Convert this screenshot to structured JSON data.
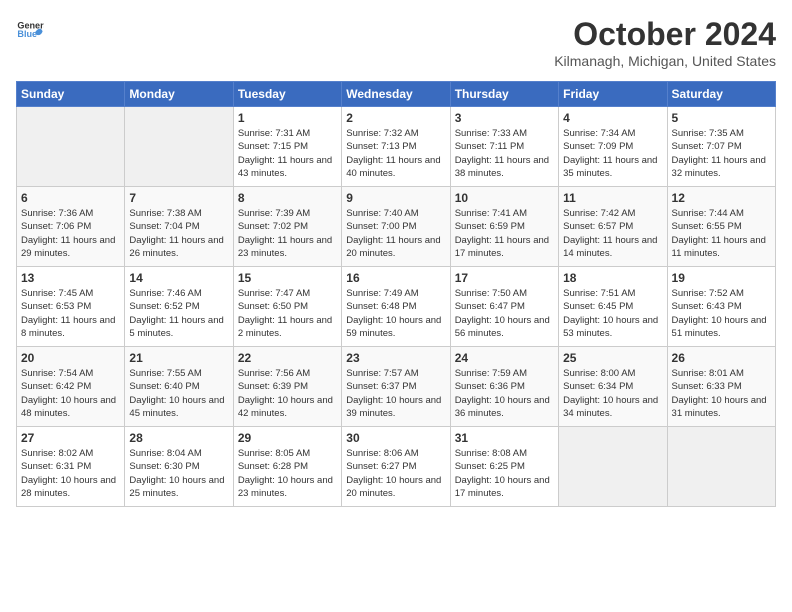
{
  "logo": {
    "general": "General",
    "blue": "Blue"
  },
  "title": "October 2024",
  "location": "Kilmanagh, Michigan, United States",
  "days_of_week": [
    "Sunday",
    "Monday",
    "Tuesday",
    "Wednesday",
    "Thursday",
    "Friday",
    "Saturday"
  ],
  "weeks": [
    [
      {
        "day": "",
        "info": ""
      },
      {
        "day": "",
        "info": ""
      },
      {
        "day": "1",
        "info": "Sunrise: 7:31 AM\nSunset: 7:15 PM\nDaylight: 11 hours and 43 minutes."
      },
      {
        "day": "2",
        "info": "Sunrise: 7:32 AM\nSunset: 7:13 PM\nDaylight: 11 hours and 40 minutes."
      },
      {
        "day": "3",
        "info": "Sunrise: 7:33 AM\nSunset: 7:11 PM\nDaylight: 11 hours and 38 minutes."
      },
      {
        "day": "4",
        "info": "Sunrise: 7:34 AM\nSunset: 7:09 PM\nDaylight: 11 hours and 35 minutes."
      },
      {
        "day": "5",
        "info": "Sunrise: 7:35 AM\nSunset: 7:07 PM\nDaylight: 11 hours and 32 minutes."
      }
    ],
    [
      {
        "day": "6",
        "info": "Sunrise: 7:36 AM\nSunset: 7:06 PM\nDaylight: 11 hours and 29 minutes."
      },
      {
        "day": "7",
        "info": "Sunrise: 7:38 AM\nSunset: 7:04 PM\nDaylight: 11 hours and 26 minutes."
      },
      {
        "day": "8",
        "info": "Sunrise: 7:39 AM\nSunset: 7:02 PM\nDaylight: 11 hours and 23 minutes."
      },
      {
        "day": "9",
        "info": "Sunrise: 7:40 AM\nSunset: 7:00 PM\nDaylight: 11 hours and 20 minutes."
      },
      {
        "day": "10",
        "info": "Sunrise: 7:41 AM\nSunset: 6:59 PM\nDaylight: 11 hours and 17 minutes."
      },
      {
        "day": "11",
        "info": "Sunrise: 7:42 AM\nSunset: 6:57 PM\nDaylight: 11 hours and 14 minutes."
      },
      {
        "day": "12",
        "info": "Sunrise: 7:44 AM\nSunset: 6:55 PM\nDaylight: 11 hours and 11 minutes."
      }
    ],
    [
      {
        "day": "13",
        "info": "Sunrise: 7:45 AM\nSunset: 6:53 PM\nDaylight: 11 hours and 8 minutes."
      },
      {
        "day": "14",
        "info": "Sunrise: 7:46 AM\nSunset: 6:52 PM\nDaylight: 11 hours and 5 minutes."
      },
      {
        "day": "15",
        "info": "Sunrise: 7:47 AM\nSunset: 6:50 PM\nDaylight: 11 hours and 2 minutes."
      },
      {
        "day": "16",
        "info": "Sunrise: 7:49 AM\nSunset: 6:48 PM\nDaylight: 10 hours and 59 minutes."
      },
      {
        "day": "17",
        "info": "Sunrise: 7:50 AM\nSunset: 6:47 PM\nDaylight: 10 hours and 56 minutes."
      },
      {
        "day": "18",
        "info": "Sunrise: 7:51 AM\nSunset: 6:45 PM\nDaylight: 10 hours and 53 minutes."
      },
      {
        "day": "19",
        "info": "Sunrise: 7:52 AM\nSunset: 6:43 PM\nDaylight: 10 hours and 51 minutes."
      }
    ],
    [
      {
        "day": "20",
        "info": "Sunrise: 7:54 AM\nSunset: 6:42 PM\nDaylight: 10 hours and 48 minutes."
      },
      {
        "day": "21",
        "info": "Sunrise: 7:55 AM\nSunset: 6:40 PM\nDaylight: 10 hours and 45 minutes."
      },
      {
        "day": "22",
        "info": "Sunrise: 7:56 AM\nSunset: 6:39 PM\nDaylight: 10 hours and 42 minutes."
      },
      {
        "day": "23",
        "info": "Sunrise: 7:57 AM\nSunset: 6:37 PM\nDaylight: 10 hours and 39 minutes."
      },
      {
        "day": "24",
        "info": "Sunrise: 7:59 AM\nSunset: 6:36 PM\nDaylight: 10 hours and 36 minutes."
      },
      {
        "day": "25",
        "info": "Sunrise: 8:00 AM\nSunset: 6:34 PM\nDaylight: 10 hours and 34 minutes."
      },
      {
        "day": "26",
        "info": "Sunrise: 8:01 AM\nSunset: 6:33 PM\nDaylight: 10 hours and 31 minutes."
      }
    ],
    [
      {
        "day": "27",
        "info": "Sunrise: 8:02 AM\nSunset: 6:31 PM\nDaylight: 10 hours and 28 minutes."
      },
      {
        "day": "28",
        "info": "Sunrise: 8:04 AM\nSunset: 6:30 PM\nDaylight: 10 hours and 25 minutes."
      },
      {
        "day": "29",
        "info": "Sunrise: 8:05 AM\nSunset: 6:28 PM\nDaylight: 10 hours and 23 minutes."
      },
      {
        "day": "30",
        "info": "Sunrise: 8:06 AM\nSunset: 6:27 PM\nDaylight: 10 hours and 20 minutes."
      },
      {
        "day": "31",
        "info": "Sunrise: 8:08 AM\nSunset: 6:25 PM\nDaylight: 10 hours and 17 minutes."
      },
      {
        "day": "",
        "info": ""
      },
      {
        "day": "",
        "info": ""
      }
    ]
  ]
}
